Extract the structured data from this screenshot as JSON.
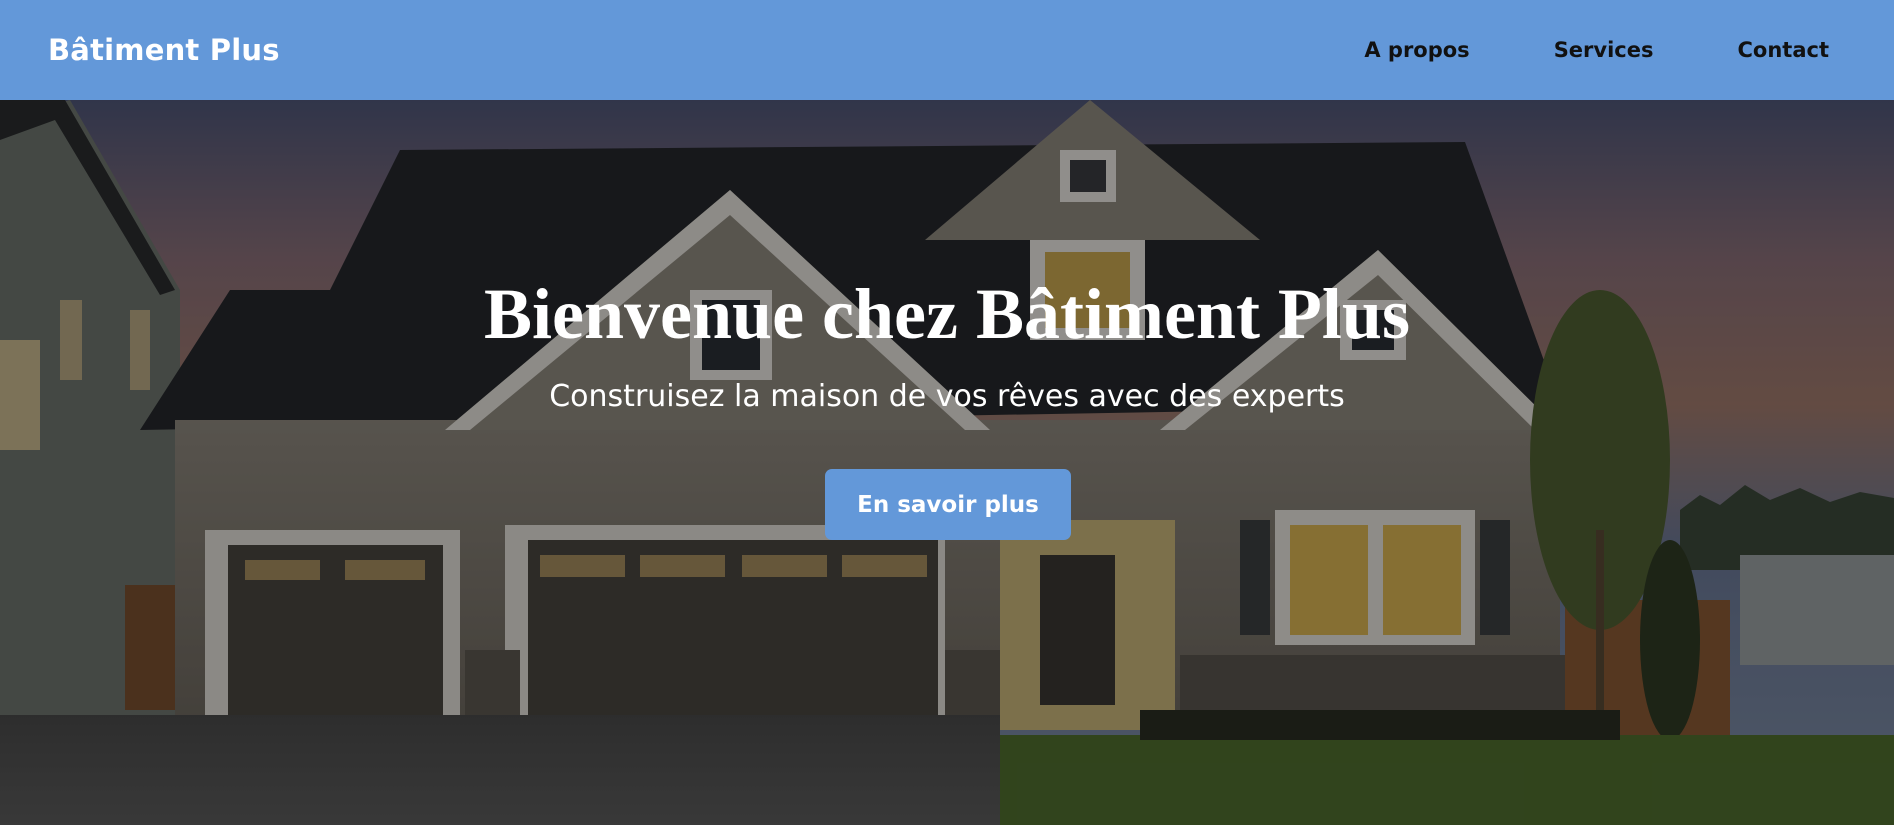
{
  "header": {
    "brand": "Bâtiment Plus",
    "nav": [
      {
        "label": "A propos"
      },
      {
        "label": "Services"
      },
      {
        "label": "Contact"
      }
    ],
    "background_color": "#6398d9"
  },
  "hero": {
    "title": "Bienvenue chez Bâtiment Plus",
    "subtitle": "Construisez la maison de vos rêves avec des experts",
    "cta_label": "En savoir plus",
    "cta_color": "#6398d9",
    "background_image": "house-dusk-photo"
  }
}
